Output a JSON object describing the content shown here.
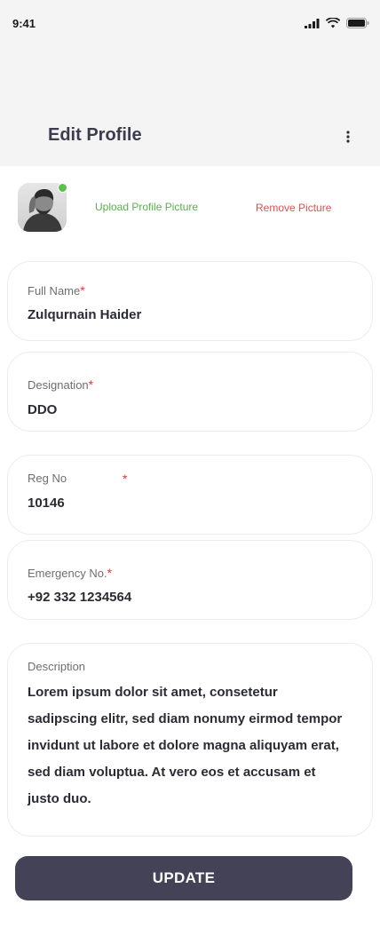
{
  "status_bar": {
    "time": "9:41"
  },
  "header": {
    "title": "Edit Profile"
  },
  "profile": {
    "upload_label": "Upload Profile Picture",
    "remove_label": "Remove Picture"
  },
  "fields": {
    "full_name": {
      "label": "Full Name",
      "required": "*",
      "value": "Zulqurnain Haider"
    },
    "designation": {
      "label": "Designation",
      "required": "*",
      "value": "DDO"
    },
    "reg_no": {
      "label": "Reg No",
      "required": "*",
      "value": "10146"
    },
    "emergency": {
      "label": "Emergency No.",
      "required": "*",
      "value": "+92 332 1234564"
    },
    "description": {
      "label": "Description",
      "value": "Lorem ipsum dolor sit amet, consetetur sadipscing elitr, sed diam nonumy eirmod tempor invidunt ut labore et dolore magna aliquyam erat, sed diam voluptua. At vero eos et accusam et justo duo."
    }
  },
  "actions": {
    "update_label": "UPDATE"
  },
  "colors": {
    "header_bg": "#f4f4f4",
    "title": "#3d3c4f",
    "upload": "#58b24c",
    "remove": "#d9534f",
    "required": "#d93a3a",
    "button_bg": "#434256",
    "online": "#5cc04d"
  },
  "icons": [
    "signal-icon",
    "wifi-icon",
    "battery-icon",
    "more-vertical-icon"
  ]
}
